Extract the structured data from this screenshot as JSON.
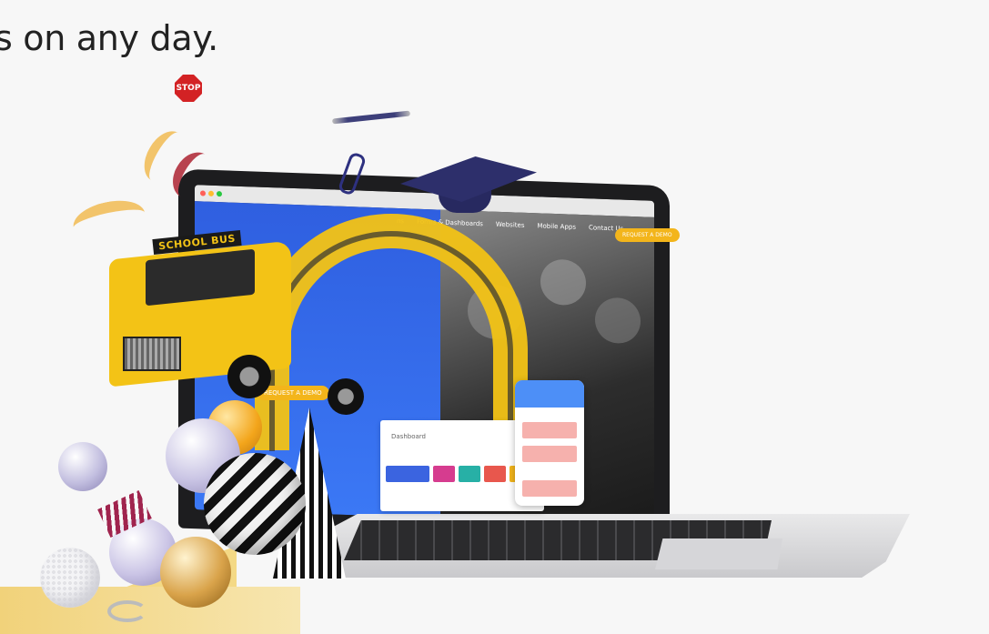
{
  "headline": {
    "text": "s on any day."
  },
  "screen": {
    "nav_items": [
      "ns",
      "Forms & Dashboards",
      "Websites",
      "Mobile Apps",
      "Contact Us"
    ],
    "nav_cta": "REQUEST A DEMO",
    "hero_cta": "REQUEST A DEMO",
    "dashboard_title": "Dashboard"
  },
  "bus": {
    "sign": "SCHOOL BUS",
    "stop": "STOP"
  },
  "colors": {
    "accent_yellow": "#f3b51b",
    "screen_blue": "#3b78f5",
    "cap_navy": "#2d2f6b"
  }
}
